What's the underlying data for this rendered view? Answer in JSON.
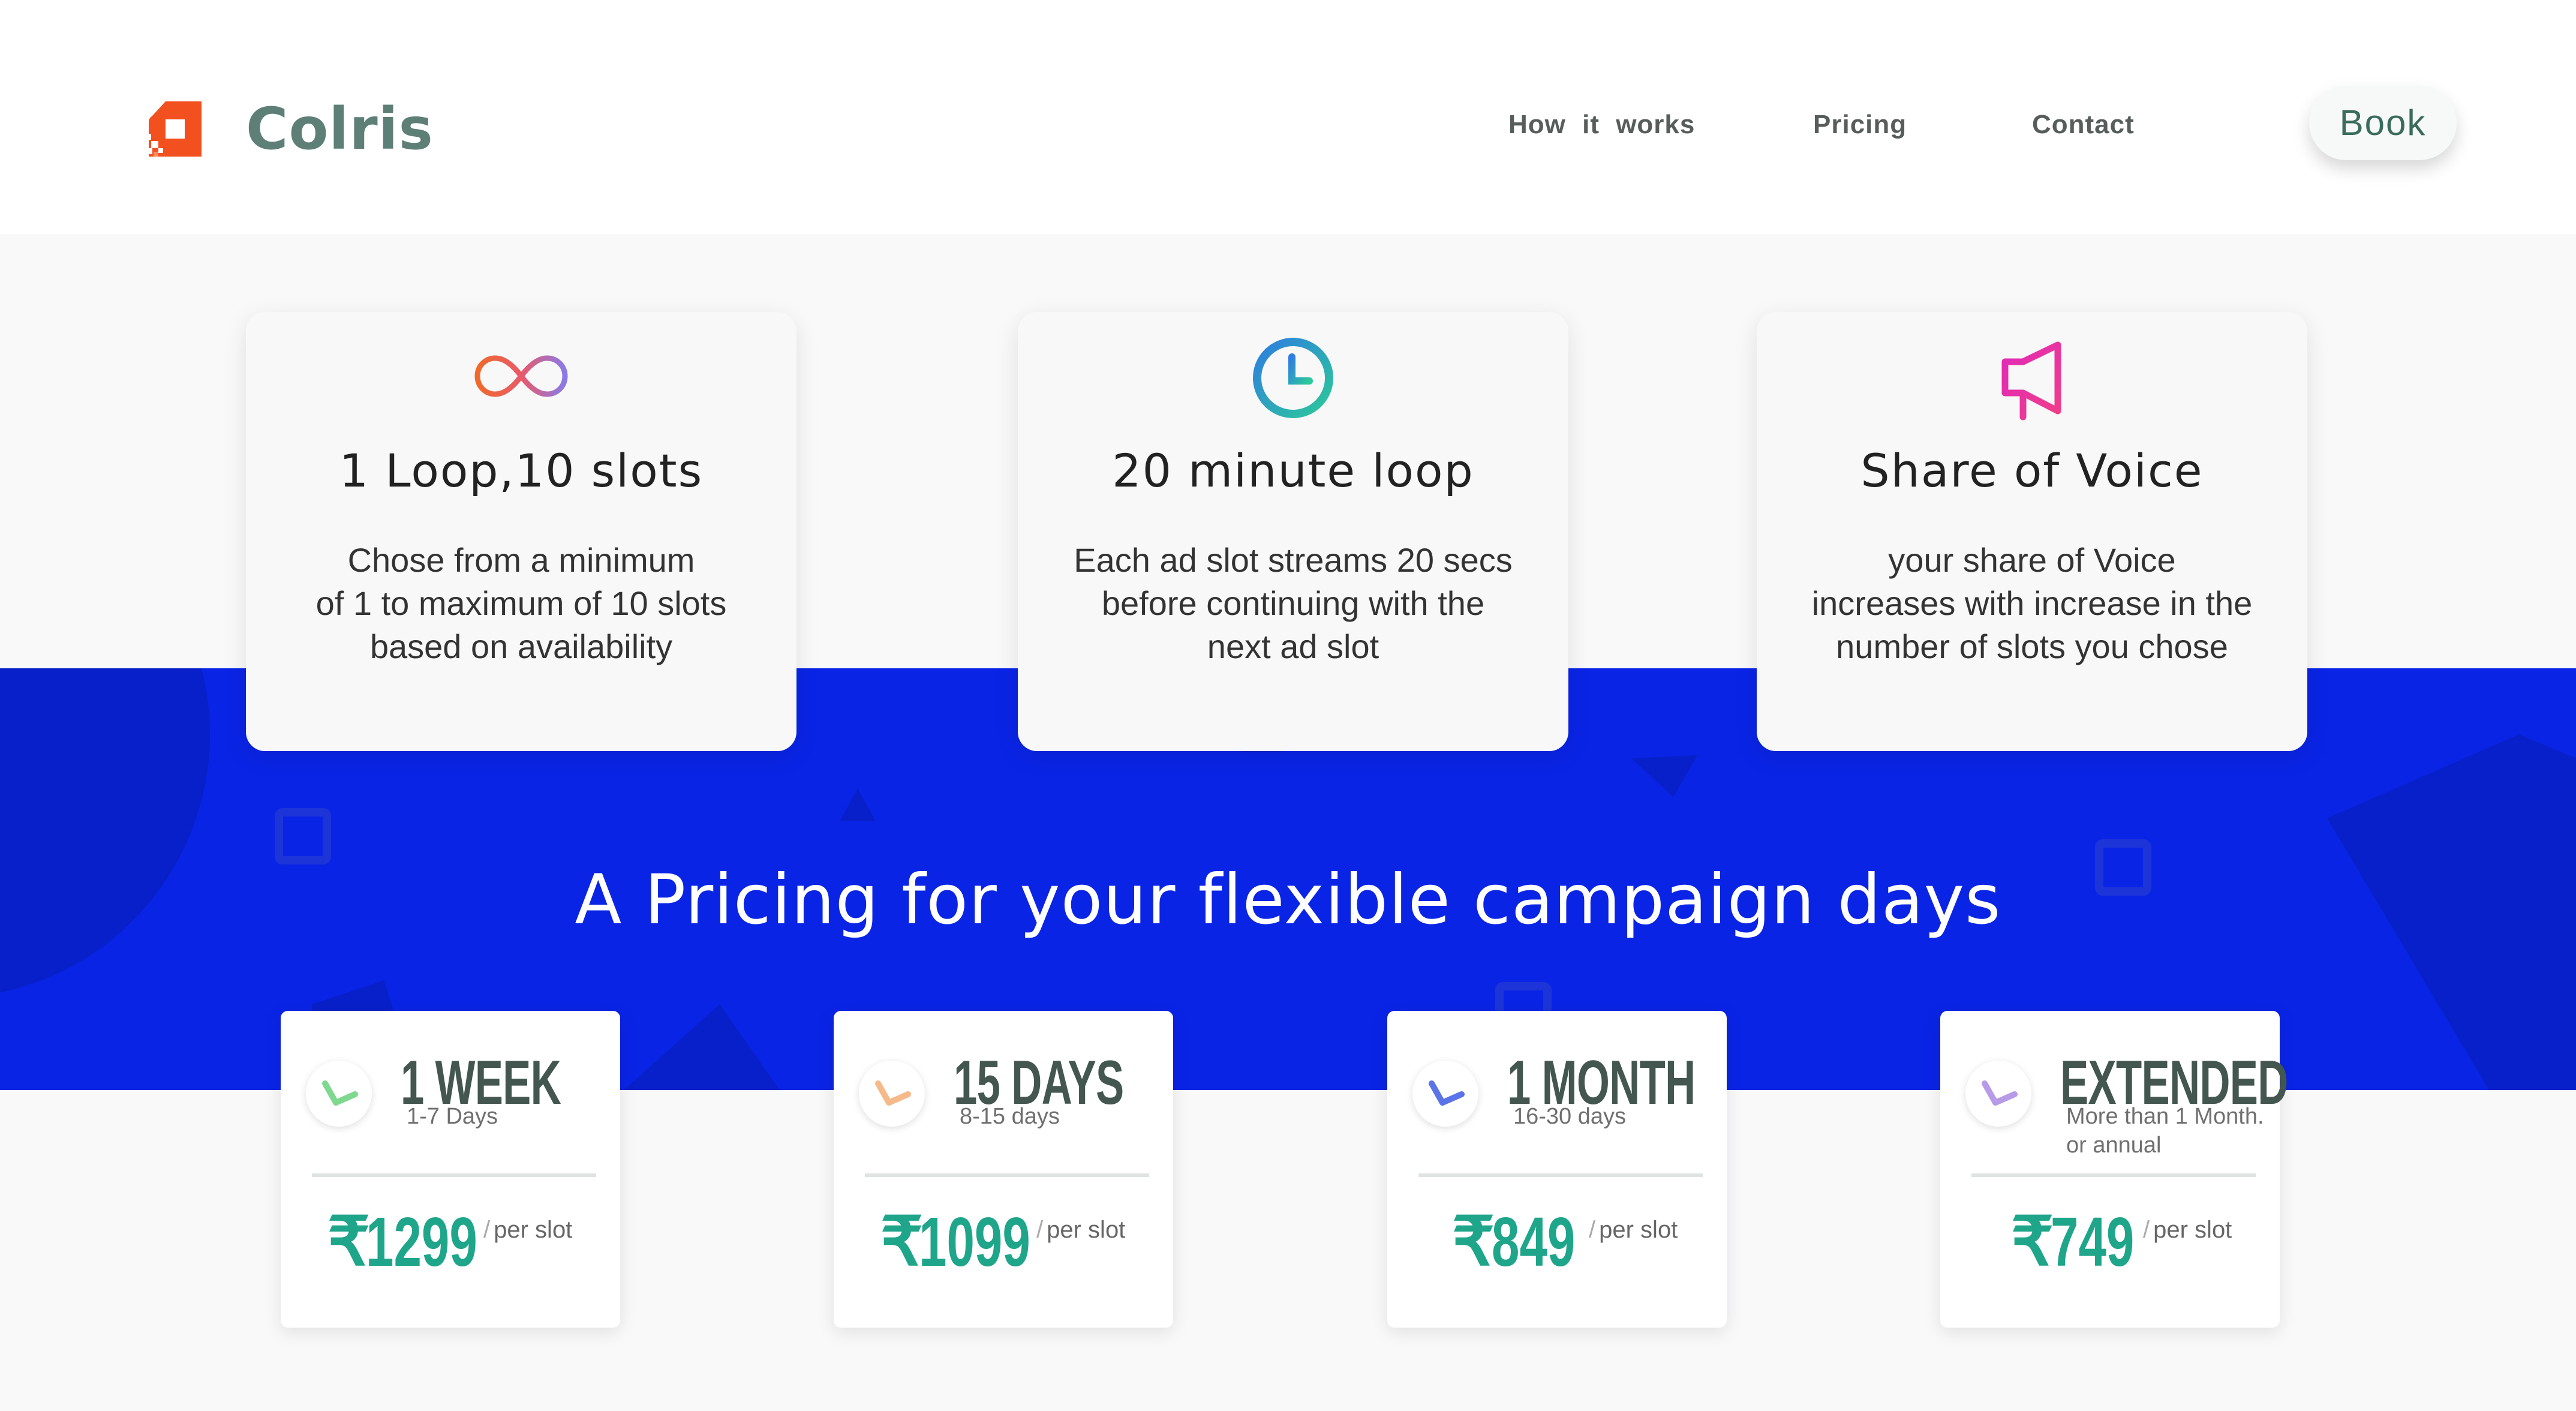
{
  "header": {
    "brand": "Colris",
    "nav": [
      "How  it  works",
      "Pricing",
      "Contact"
    ],
    "cta": "Book"
  },
  "features": [
    {
      "icon": "infinity-icon",
      "title": "1 Loop,10 slots",
      "lines": [
        "Chose from a minimum",
        "of 1 to maximum of 10 slots",
        "based on availability"
      ]
    },
    {
      "icon": "clock-icon",
      "title": "20 minute loop",
      "lines": [
        "Each ad slot streams 20 secs",
        "before continuing with the",
        "next ad slot"
      ]
    },
    {
      "icon": "megaphone-icon",
      "title": "Share of Voice",
      "lines": [
        "your share of Voice",
        "increases with increase in the",
        "number of slots you chose"
      ]
    }
  ],
  "pricing": {
    "headline": "A Pricing for your flexible campaign days",
    "currency": "₹",
    "unit": "per slot",
    "plans": [
      {
        "title": "1 WEEK",
        "subtitle": "1-7 Days",
        "price": "1299",
        "accent": "#7ed98f"
      },
      {
        "title": "15 DAYS",
        "subtitle": "8-15 days",
        "price": "1099",
        "accent": "#f5b98a"
      },
      {
        "title": "1 MONTH",
        "subtitle": "16-30 days",
        "price": "849",
        "accent": "#5a73e8"
      },
      {
        "title": "EXTENDED",
        "subtitle": "More than 1 Month. or annual",
        "price": "749",
        "accent": "#b79ae8"
      }
    ]
  },
  "colors": {
    "brand_text": "#5e7f76",
    "band_blue": "#0a24e6",
    "price_green": "#1ea58a",
    "logo_orange": "#f2501f"
  }
}
